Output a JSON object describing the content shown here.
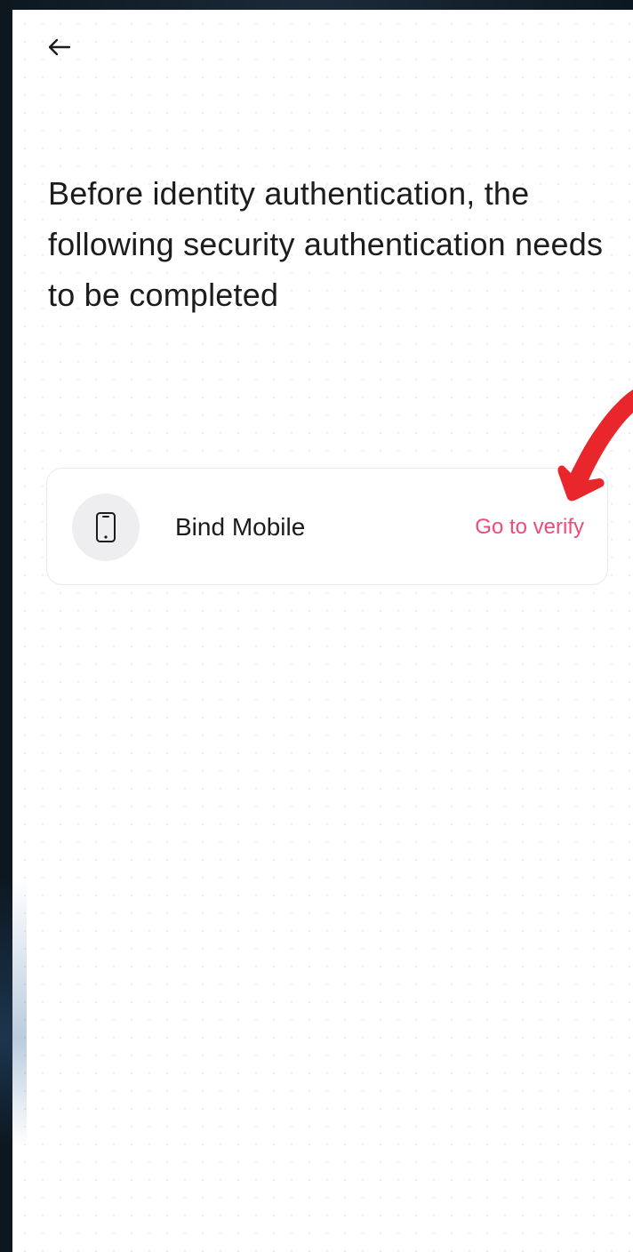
{
  "header": {
    "back_icon": "arrow-left-icon"
  },
  "main": {
    "headline": "Before identity authentication, the following security authentication needs to be completed"
  },
  "security_items": [
    {
      "icon": "smartphone-icon",
      "label": "Bind Mobile",
      "action_label": "Go to verify"
    }
  ],
  "colors": {
    "accent": "#ef4a7a",
    "annotation": "#e8262b",
    "text": "#1c1c1c",
    "icon_bg": "#eeeef1"
  }
}
